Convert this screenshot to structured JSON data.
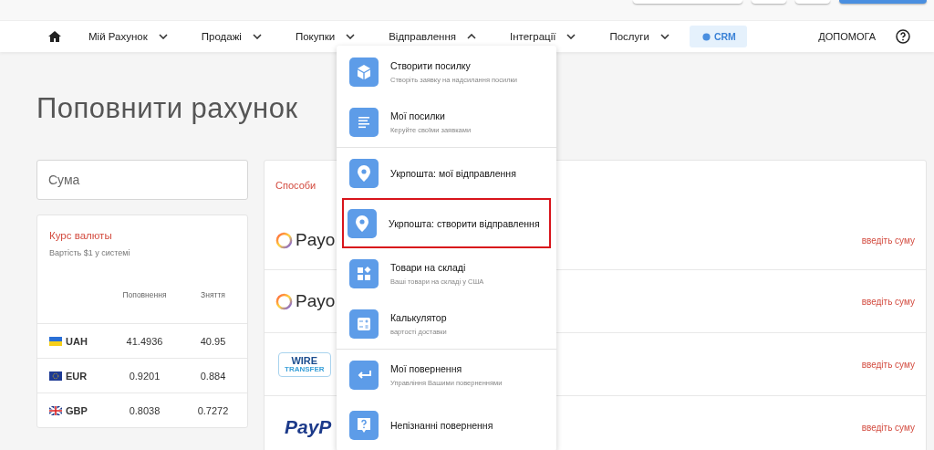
{
  "nav": {
    "items": [
      {
        "label": "Мій Рахунок",
        "expanded": false
      },
      {
        "label": "Продажі",
        "expanded": false
      },
      {
        "label": "Покупки",
        "expanded": false
      },
      {
        "label": "Відправлення",
        "expanded": true
      },
      {
        "label": "Інтеграції",
        "expanded": false
      },
      {
        "label": "Послуги",
        "expanded": false
      }
    ],
    "crm": "CRM",
    "help": "ДОПОМОГА"
  },
  "page_title": "Поповнити рахунок",
  "amount_field": {
    "placeholder": "Сума"
  },
  "rates": {
    "title": "Курс валюты",
    "subtitle": "Вартість $1 у системі",
    "columns": [
      "Поповнення",
      "Зняття"
    ],
    "rows": [
      {
        "code": "UAH",
        "deposit": "41.4936",
        "withdraw": "40.95"
      },
      {
        "code": "EUR",
        "deposit": "0.9201",
        "withdraw": "0.884"
      },
      {
        "code": "GBP",
        "deposit": "0.8038",
        "withdraw": "0.7272"
      }
    ]
  },
  "methods": {
    "title": "Способи",
    "rows": [
      {
        "kind": "payon",
        "logo": "Payo",
        "hint": "введіть суму"
      },
      {
        "kind": "payon",
        "logo": "Payo",
        "hint": "введіть суму"
      },
      {
        "kind": "wire",
        "logo": "WIRE",
        "logo_sub": "TRANSFER",
        "hint": "введіть суму"
      },
      {
        "kind": "paypal",
        "logo": "PayP",
        "hint": "введіть суму"
      }
    ]
  },
  "dropdown": {
    "sections": [
      {
        "items": [
          {
            "title": "Створити посилку",
            "subtitle": "Створіть заявку на надсилання посилки",
            "highlighted": false
          },
          {
            "title": "Мої посилки",
            "subtitle": "Керуйте своїми заявками",
            "highlighted": false
          }
        ]
      },
      {
        "items": [
          {
            "title": "Укрпошта: мої відправлення",
            "highlighted": false
          },
          {
            "title": "Укрпошта: створити відправлення",
            "highlighted": true
          },
          {
            "title": "Товари на складі",
            "subtitle": "Ваші товари на складі у США",
            "highlighted": false
          },
          {
            "title": "Калькулятор",
            "subtitle": "вартості доставки",
            "highlighted": false
          }
        ]
      },
      {
        "items": [
          {
            "title": "Мої повернення",
            "subtitle": "Управління Вашими поверненнями",
            "highlighted": false
          },
          {
            "title": "Непізнанні повернення",
            "highlighted": false
          }
        ]
      }
    ]
  }
}
